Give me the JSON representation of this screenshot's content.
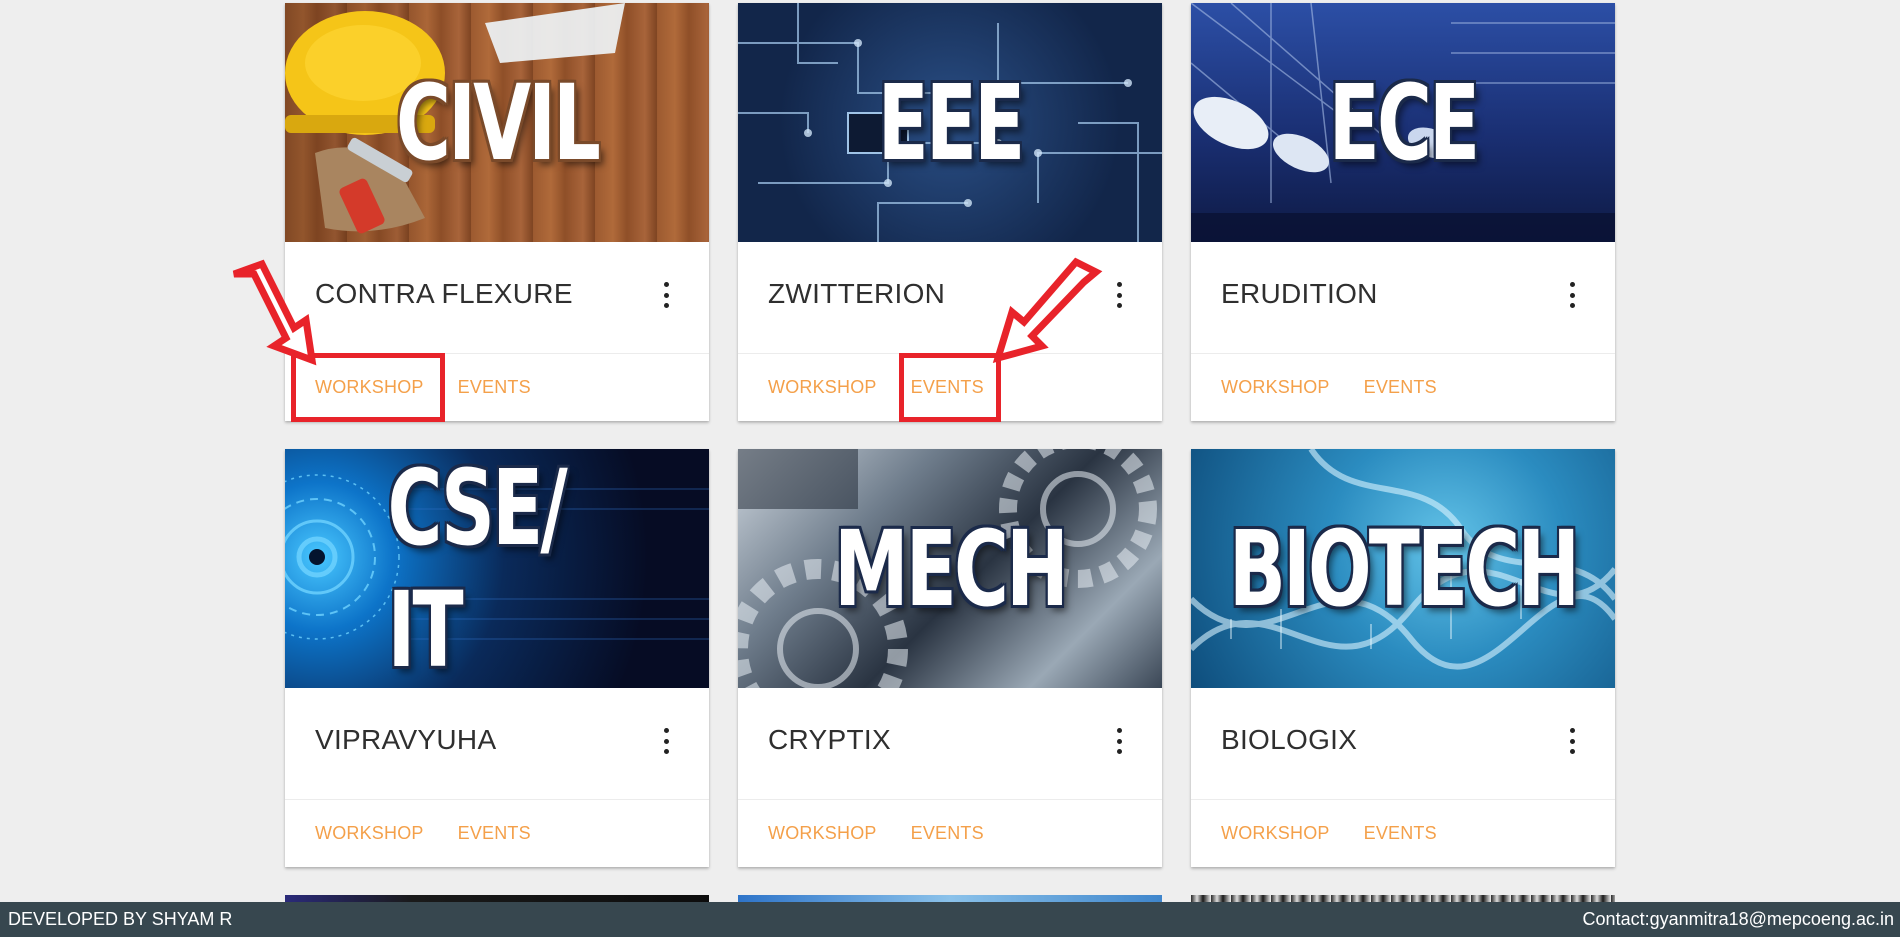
{
  "cards": [
    {
      "banner": "CIVIL",
      "title": "CONTRA FLEXURE",
      "workshop_label": "WORKSHOP",
      "events_label": "EVENTS",
      "image_hint": "hard-hat-on-wood"
    },
    {
      "banner": "EEE",
      "title": "ZWITTERION",
      "workshop_label": "WORKSHOP",
      "events_label": "EVENTS",
      "image_hint": "circuit-board"
    },
    {
      "banner": "ECE",
      "title": "ERUDITION",
      "workshop_label": "WORKSHOP",
      "events_label": "EVENTS",
      "image_hint": "satellite-dishes"
    },
    {
      "banner": "CSE/ IT",
      "title": "VIPRAVYUHA",
      "workshop_label": "WORKSHOP",
      "events_label": "EVENTS",
      "image_hint": "blue-digital-eye"
    },
    {
      "banner": "MECH",
      "title": "CRYPTIX",
      "workshop_label": "WORKSHOP",
      "events_label": "EVENTS",
      "image_hint": "metal-gears"
    },
    {
      "banner": "BIOTECH",
      "title": "BIOLOGIX",
      "workshop_label": "WORKSHOP",
      "events_label": "EVENTS",
      "image_hint": "dna-helix"
    }
  ],
  "footer": {
    "developer": "DEVELOPED BY SHYAM R",
    "contact": "Contact:gyanmitra18@mepcoeng.ac.in"
  },
  "colors": {
    "page_background": "#eeeeee",
    "card_background": "#ffffff",
    "action_link": "#f4a04a",
    "title_text": "#2f2f2f",
    "footer_background": "#37474f",
    "annotation": "#e8232a"
  },
  "icons": {
    "card_menu": "more-vert-icon",
    "annotation_arrow": "red-arrow-icon"
  }
}
